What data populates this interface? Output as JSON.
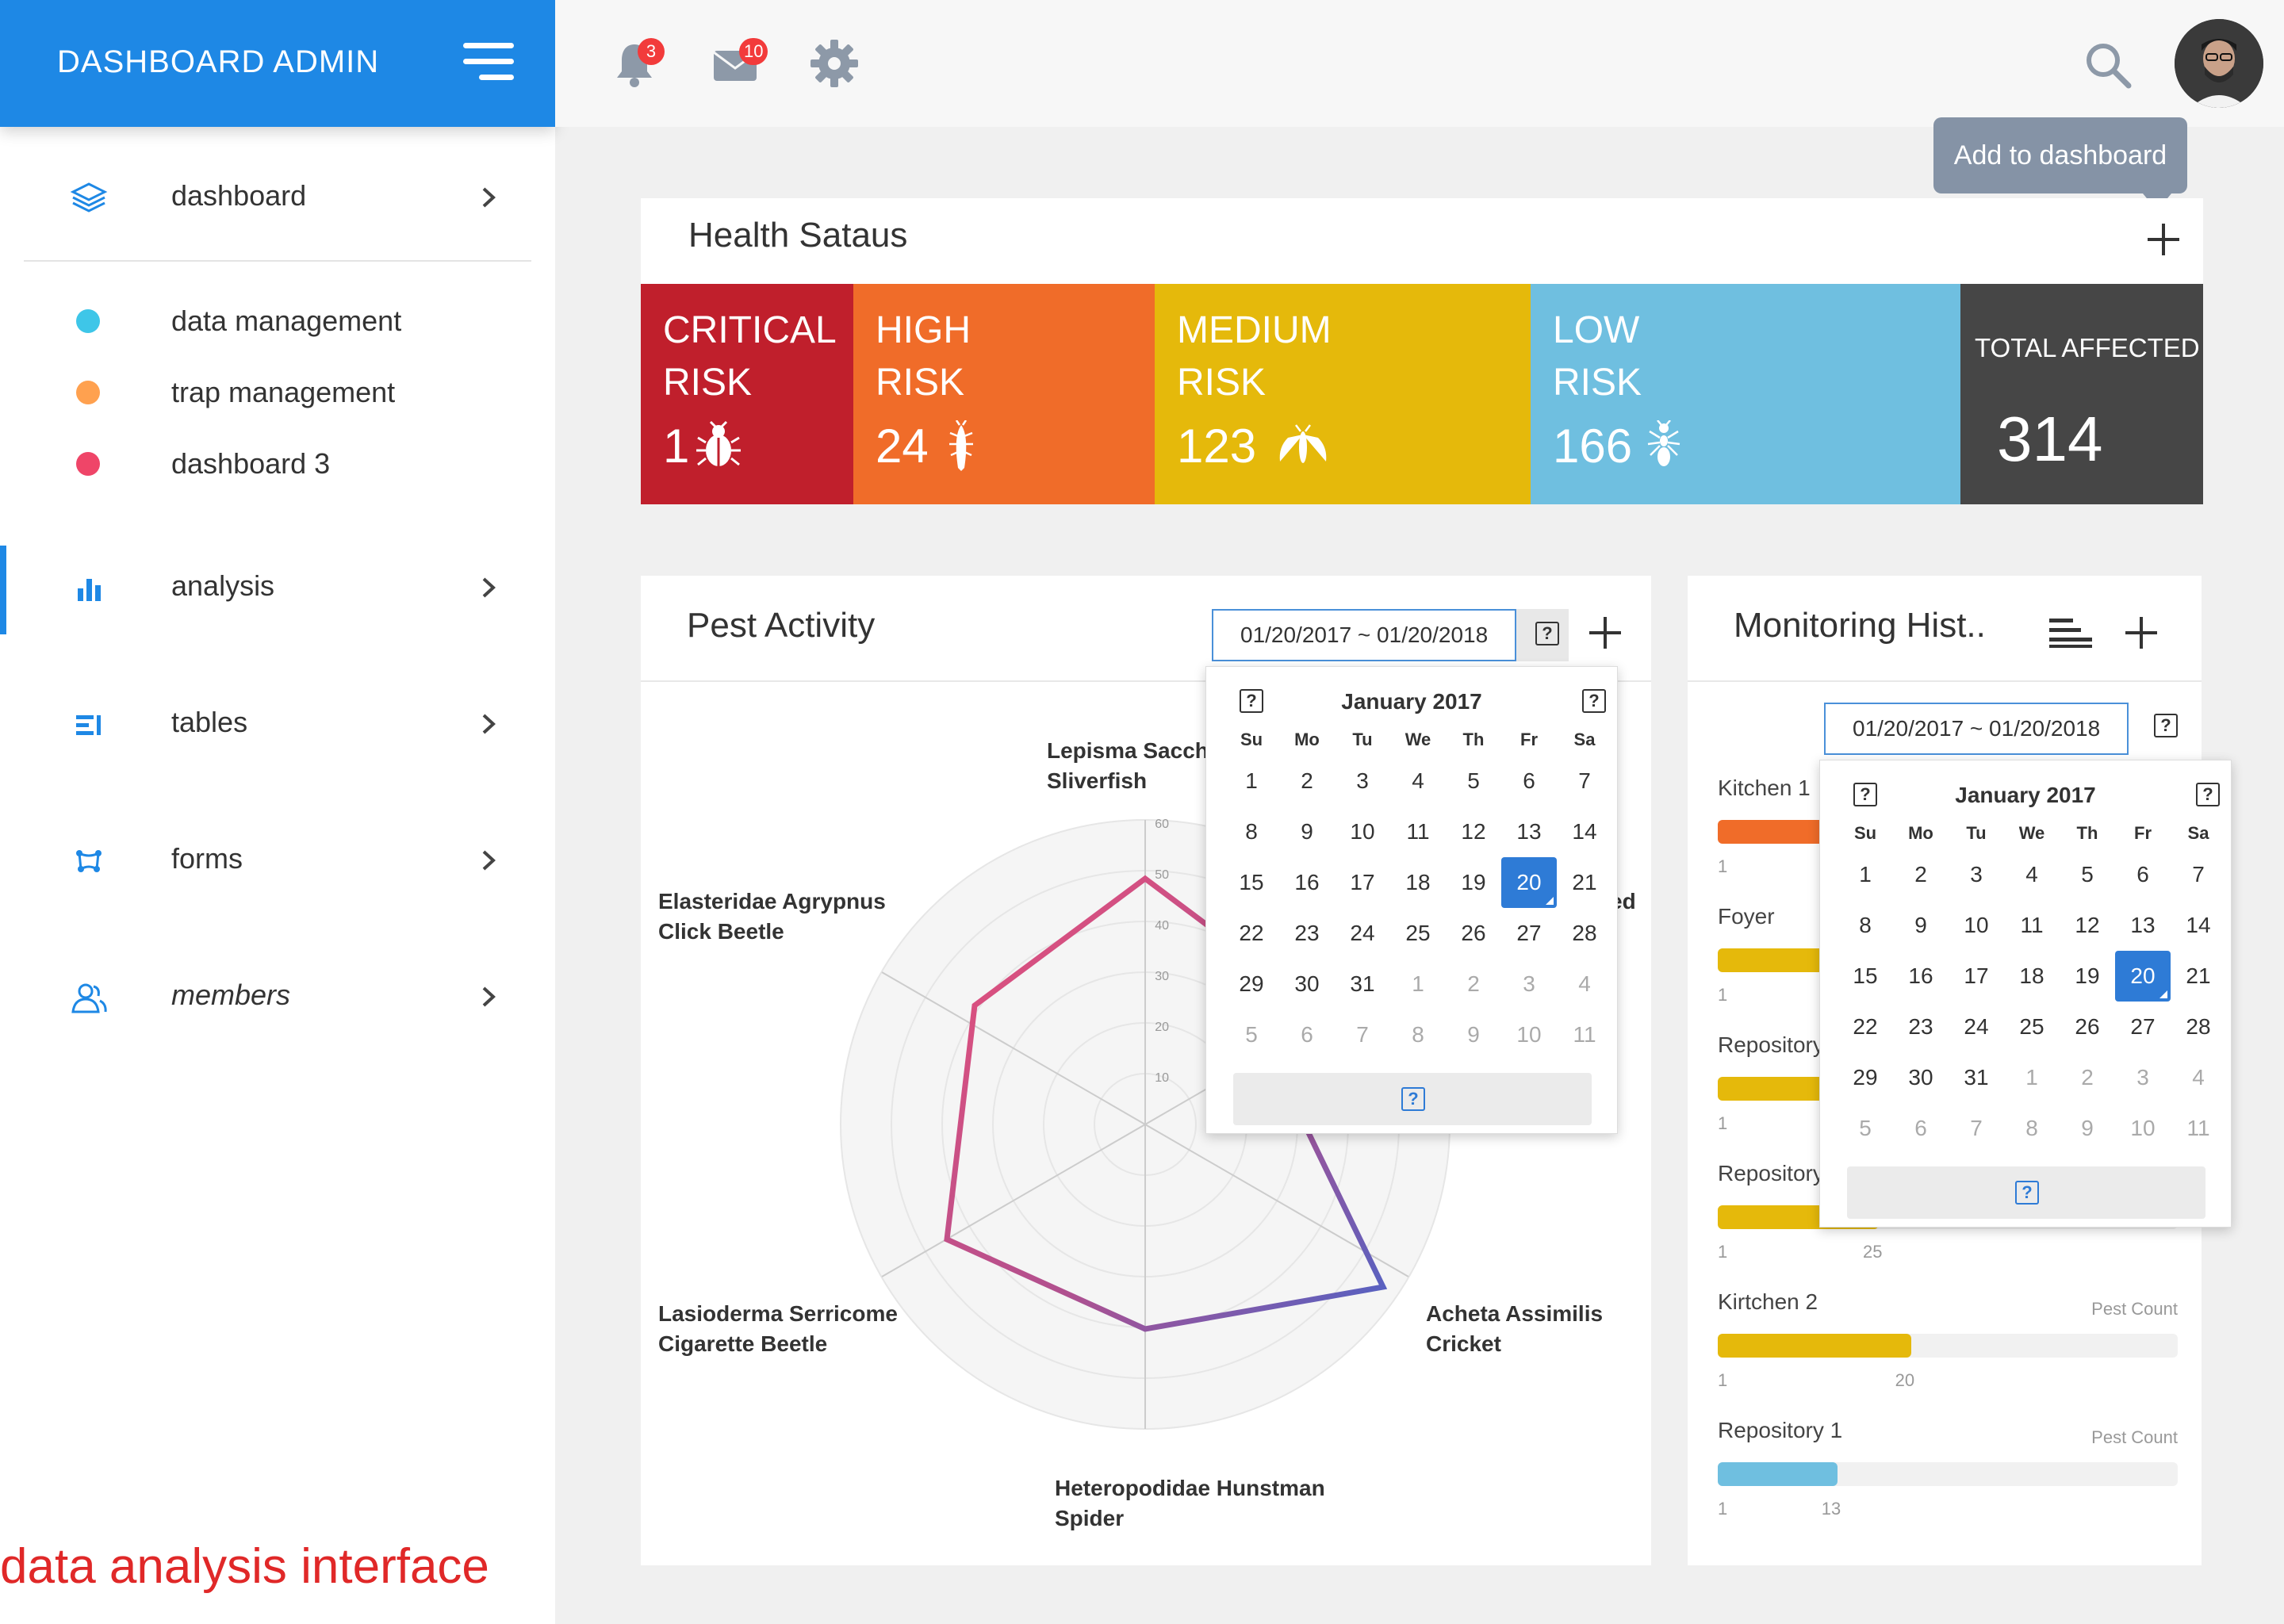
{
  "brand": {
    "title": "DASHBOARD ADMIN"
  },
  "sidebar": {
    "nav": [
      {
        "label": "dashboard"
      },
      {
        "label": "analysis"
      },
      {
        "label": "tables"
      },
      {
        "label": "forms"
      },
      {
        "label": "members"
      }
    ],
    "sub": [
      {
        "label": "data management",
        "color": "#3ec6e8"
      },
      {
        "label": "trap management",
        "color": "#ffa14f"
      },
      {
        "label": "dashboard 3",
        "color": "#ef4568"
      }
    ],
    "caption": "data analysis interface",
    "accent": "#1e88e5"
  },
  "topbar": {
    "notifications_count": "3",
    "messages_count": "10",
    "tooltip": "Add to dashboard"
  },
  "health": {
    "title": "Health Sataus",
    "risks": [
      {
        "name": "CRITICAL\nRISK",
        "value": "1",
        "color": "#c01f2c",
        "icon": "beetle-icon"
      },
      {
        "name": "HIGH\nRISK",
        "value": "24",
        "color": "#f06c29",
        "icon": "silverfish-icon"
      },
      {
        "name": "MEDIUM\nRISK",
        "value": "123",
        "color": "#e5b90b",
        "icon": "moth-icon"
      },
      {
        "name": "LOW\nRISK",
        "value": "166",
        "color": "#6fbfe0",
        "icon": "ant-icon"
      }
    ],
    "total": {
      "label": "TOTAL AFFECTED",
      "value": "314",
      "color": "#464646"
    }
  },
  "pest": {
    "title": "Pest Activity",
    "date_range": "01/20/2017 ~ 01/20/2018",
    "radar_labels": [
      {
        "text": "Lepisma Saccha\nSliverfish"
      },
      {
        "text": "Elasteridae Agrypnus\nClick Beetle"
      },
      {
        "text": "ed"
      },
      {
        "text": "Lasioderma Serricome\nCigarette Beetle"
      },
      {
        "text": "Acheta Assimilis\nCricket"
      },
      {
        "text": "Heteropodidae Hunstman\nSpider"
      }
    ],
    "radar_ticks": [
      "60",
      "50",
      "40",
      "30",
      "20",
      "10"
    ]
  },
  "calendar": {
    "title": "January 2017",
    "dow": [
      "Su",
      "Mo",
      "Tu",
      "We",
      "Th",
      "Fr",
      "Sa"
    ],
    "weeks": [
      [
        "1",
        "2",
        "3",
        "4",
        "5",
        "6",
        "7"
      ],
      [
        "8",
        "9",
        "10",
        "11",
        "12",
        "13",
        "14"
      ],
      [
        "15",
        "16",
        "17",
        "18",
        "19",
        "20",
        "21"
      ],
      [
        "22",
        "23",
        "24",
        "25",
        "26",
        "27",
        "28"
      ],
      [
        "29",
        "30",
        "31",
        "1",
        "2",
        "3",
        "4"
      ],
      [
        "5",
        "6",
        "7",
        "8",
        "9",
        "10",
        "11"
      ]
    ],
    "selected": "20"
  },
  "monitor": {
    "title": "Monitoring Hist..",
    "date_range": "01/20/2017 ~ 01/20/2018",
    "rows": [
      {
        "name": "Kitchen 1",
        "min": "1",
        "value": "",
        "meta": "",
        "color": "#f06c29",
        "fill": 0.4
      },
      {
        "name": "Foyer",
        "min": "1",
        "value": "",
        "meta": "",
        "color": "#e5b90b",
        "fill": 0.35
      },
      {
        "name": "Repository",
        "min": "1",
        "value": "",
        "meta": "",
        "color": "#e5b90b",
        "fill": 0.35
      },
      {
        "name": "Repository",
        "min": "1",
        "value": "25",
        "meta": "",
        "color": "#e5b90b",
        "fill": 0.35
      },
      {
        "name": "Kirtchen 2",
        "min": "1",
        "value": "20",
        "meta": "Pest Count",
        "color": "#e5b90b",
        "fill": 0.42
      },
      {
        "name": "Repository 1",
        "min": "1",
        "value": "13",
        "meta": "Pest Count",
        "color": "#6fbfe0",
        "fill": 0.26
      }
    ]
  }
}
